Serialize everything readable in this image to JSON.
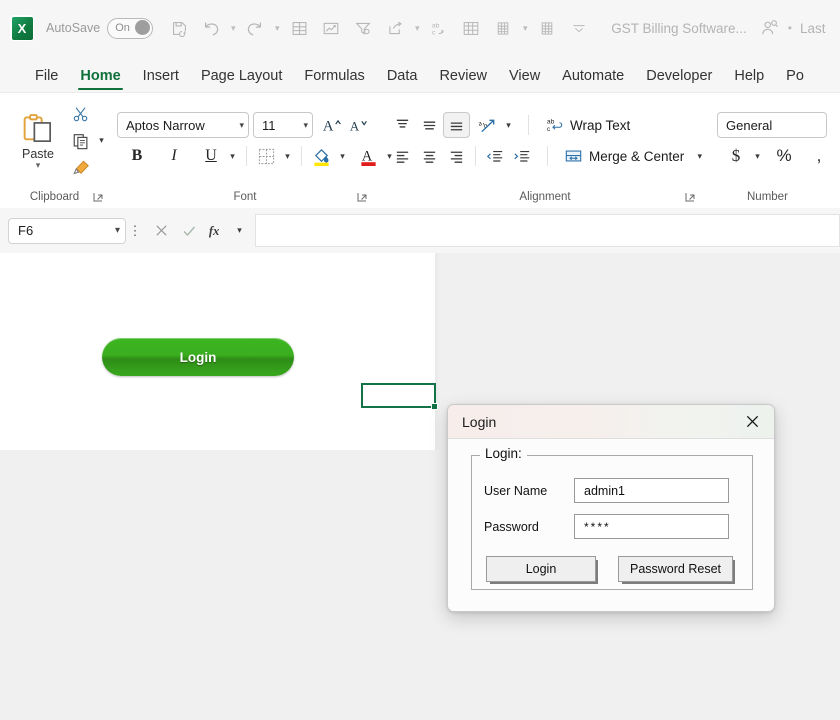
{
  "titlebar": {
    "app_icon": "excel-logo",
    "app_letter": "X",
    "autosave_label": "AutoSave",
    "autosave_state": "On",
    "document_title": "GST Billing Software...",
    "last_text": "Last",
    "separator_dot": "•",
    "qat_icons": [
      "save-icon",
      "undo-icon",
      "undo-caret",
      "redo-icon",
      "redo-caret",
      "table-icon",
      "chart-icon",
      "filter-icon",
      "share-icon",
      "share-caret",
      "spelling-icon",
      "freeze-panes-icon",
      "sheet-icon",
      "sheet-caret",
      "sheet-icon-2",
      "customize-qat-caret"
    ]
  },
  "tabs": [
    {
      "label": "File",
      "active": false
    },
    {
      "label": "Home",
      "active": true
    },
    {
      "label": "Insert",
      "active": false
    },
    {
      "label": "Page Layout",
      "active": false
    },
    {
      "label": "Formulas",
      "active": false
    },
    {
      "label": "Data",
      "active": false
    },
    {
      "label": "Review",
      "active": false
    },
    {
      "label": "View",
      "active": false
    },
    {
      "label": "Automate",
      "active": false
    },
    {
      "label": "Developer",
      "active": false
    },
    {
      "label": "Help",
      "active": false
    },
    {
      "label": "Po",
      "active": false
    }
  ],
  "ribbon": {
    "clipboard": {
      "group_label": "Clipboard",
      "paste_label": "Paste",
      "cut_icon": "scissors-icon",
      "copy_icon": "copy-icon",
      "copy_caret": "chevron-down-icon",
      "format_painter_icon": "format-painter-icon",
      "paste_caret": "chevron-down-icon",
      "dialog_launcher": "dialog-launcher-icon"
    },
    "font": {
      "group_label": "Font",
      "font_family_value": "Aptos Narrow",
      "font_size_value": "11",
      "grow_font_label": "A",
      "shrink_font_label": "A",
      "bold_label": "B",
      "italic_label": "I",
      "underline_label": "U",
      "borders_icon": "borders-icon",
      "fill_color_icon": "fill-color-icon",
      "font_color_label": "A",
      "dialog_launcher": "dialog-launcher-icon"
    },
    "alignment": {
      "group_label": "Alignment",
      "align_top_icon": "align-top-icon",
      "align_middle_icon": "align-middle-icon",
      "align_bottom_icon": "align-bottom-icon",
      "orientation_icon": "orientation-icon",
      "wrap_text_label": "Wrap Text",
      "align_left_icon": "align-left-icon",
      "align_center_icon": "align-center-icon",
      "align_right_icon": "align-right-icon",
      "decrease_indent_icon": "decrease-indent-icon",
      "increase_indent_icon": "increase-indent-icon",
      "merge_center_label": "Merge & Center",
      "dialog_launcher": "dialog-launcher-icon"
    },
    "number": {
      "group_label": "Number",
      "format_value": "General",
      "currency_label": "$",
      "percent_label": "%",
      "comma_label": ","
    }
  },
  "formula_bar": {
    "name_box_value": "F6",
    "cancel_icon": "cancel-x-icon",
    "enter_icon": "confirm-check-icon",
    "function_icon": "fx-icon",
    "function_caret": "chevron-down-icon",
    "formula_value": ""
  },
  "sheet": {
    "login_button_label": "Login",
    "selected_cell": "F6"
  },
  "dialog": {
    "title": "Login",
    "close_icon": "close-icon",
    "fieldset_legend": "Login:",
    "username_label": "User Name",
    "username_value": "admin1",
    "password_label": "Password",
    "password_value": "****",
    "login_button_label": "Login",
    "password_reset_button_label": "Password Reset"
  },
  "colors": {
    "excel_green": "#107c41",
    "tab_active": "#0f703b",
    "login_button_green": "#3aae1f",
    "selection_border": "#137347",
    "dialog_titlebar": "#f5efec"
  }
}
